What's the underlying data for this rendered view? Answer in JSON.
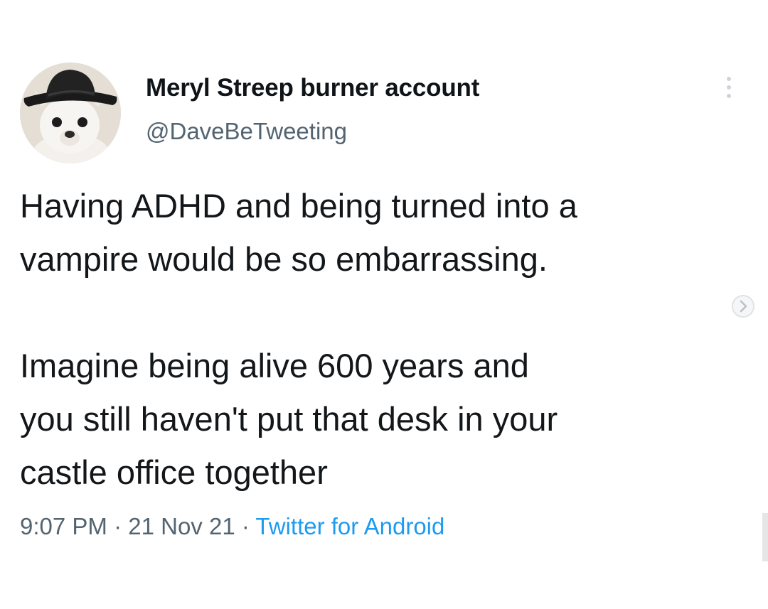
{
  "tweet": {
    "author": {
      "display_name": "Meryl Streep burner account",
      "handle": "@DaveBeTweeting",
      "avatar_icon": "avatar-dog-in-cowboy-hat"
    },
    "text_paragraphs": [
      "Having ADHD and being turned into a\nvampire would be so embarrassing.",
      "Imagine being alive 600 years and\nyou still haven't put that desk in your\ncastle office together"
    ],
    "meta": {
      "time": "9:07 PM",
      "separator_1": " · ",
      "date": "21 Nov 21",
      "separator_2": " · ",
      "source": "Twitter for Android"
    },
    "colors": {
      "text": "#14171a",
      "secondary": "#536471",
      "link": "#1d9bf0"
    }
  }
}
